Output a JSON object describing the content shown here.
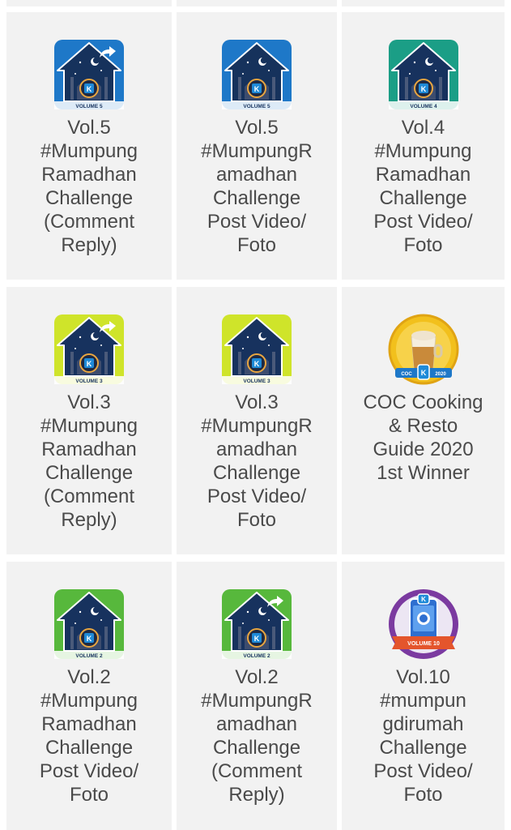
{
  "badges": [
    {
      "title": "Vol.5\n#Mumpung\nRamadhan\nChallenge\n(Comment\nReply)",
      "icon": "house-badge-icon",
      "bg": "#1e78c8",
      "house": "#16325c",
      "volume": "VOLUME 5",
      "reply": true
    },
    {
      "title": "Vol.5\n#MumpungR\namadhan\nChallenge\nPost Video/\nFoto",
      "icon": "house-badge-icon",
      "bg": "#1e78c8",
      "house": "#16325c",
      "volume": "VOLUME 5",
      "reply": false
    },
    {
      "title": "Vol.4\n#Mumpung\nRamadhan\nChallenge\nPost Video/\nFoto",
      "icon": "house-badge-icon",
      "bg": "#1b9e86",
      "house": "#17325e",
      "volume": "VOLUME 4",
      "reply": false
    },
    {
      "title": "Vol.3\n#Mumpung\nRamadhan\nChallenge\n(Comment\nReply)",
      "icon": "house-badge-icon",
      "bg": "#cfe42a",
      "house": "#17325e",
      "volume": "VOLUME 3",
      "reply": true
    },
    {
      "title": "Vol.3\n#MumpungR\namadhan\nChallenge\nPost Video/\nFoto",
      "icon": "house-badge-icon",
      "bg": "#cfe42a",
      "house": "#17325e",
      "volume": "VOLUME 3",
      "reply": false
    },
    {
      "title": "COC Cooking\n& Resto\nGuide 2020\n1st Winner",
      "icon": "coc-trophy-icon",
      "bg": "#f2c01c",
      "house": "#c98a3a",
      "volume": "COC 2020",
      "reply": false
    },
    {
      "title": "Vol.2\n#Mumpung\nRamadhan\nChallenge\nPost Video/\nFoto",
      "icon": "house-badge-icon",
      "bg": "#57b83c",
      "house": "#17325e",
      "volume": "VOLUME 2",
      "reply": false
    },
    {
      "title": "Vol.2\n#MumpungR\namadhan\nChallenge\n(Comment\nReply)",
      "icon": "house-badge-icon",
      "bg": "#57b83c",
      "house": "#17325e",
      "volume": "VOLUME 2",
      "reply": true
    },
    {
      "title": "Vol.10\n#mumpun\ngdirumah\nChallenge\nPost Video/\nFoto",
      "icon": "camera-badge-icon",
      "bg": "#7b3aa0",
      "house": "#2e6fd0",
      "volume": "VOLUME 10",
      "reply": false
    }
  ]
}
